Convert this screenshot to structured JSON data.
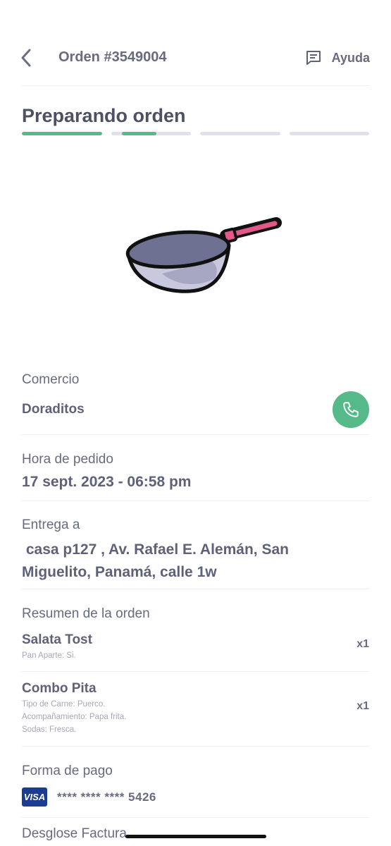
{
  "header": {
    "order_title": "Orden #3549004",
    "help_label": "Ayuda"
  },
  "status": {
    "title": "Preparando orden",
    "steps": [
      {
        "fill": 1.0
      },
      {
        "fill": 0.65
      },
      {
        "fill": 0.0
      },
      {
        "fill": 0.0
      }
    ],
    "accent_color": "#55b98a",
    "track_color": "#e1e1ea"
  },
  "merchant": {
    "label": "Comercio",
    "name": "Doraditos"
  },
  "order_time": {
    "label": "Hora de pedido",
    "value": "17 sept. 2023 - 06:58 pm"
  },
  "delivery": {
    "label": "Entrega a",
    "address_line1": " casa p127 , Av. Rafael E. Alemán, San",
    "address_line2": "Miguelito, Panamá, calle 1w"
  },
  "summary": {
    "label": "Resumen de la orden",
    "items": [
      {
        "name": "Salata Tost",
        "details": [
          "Pan Aparte: Si."
        ],
        "qty": "x1"
      },
      {
        "name": "Combo Pita",
        "details": [
          "Tipo de Carne: Puerco.",
          "Acompañamiento: Papa frita.",
          "Sodas: Fresca."
        ],
        "qty": "x1"
      }
    ]
  },
  "payment": {
    "label": "Forma de pago",
    "card_brand": "VISA",
    "card_number": "**** **** **** 5426"
  },
  "invoice": {
    "label": "Desglose Factura"
  },
  "icons": {
    "back": "chevron-left-icon",
    "help": "chat-icon",
    "call": "phone-icon",
    "illustration": "frying-pan-icon"
  }
}
